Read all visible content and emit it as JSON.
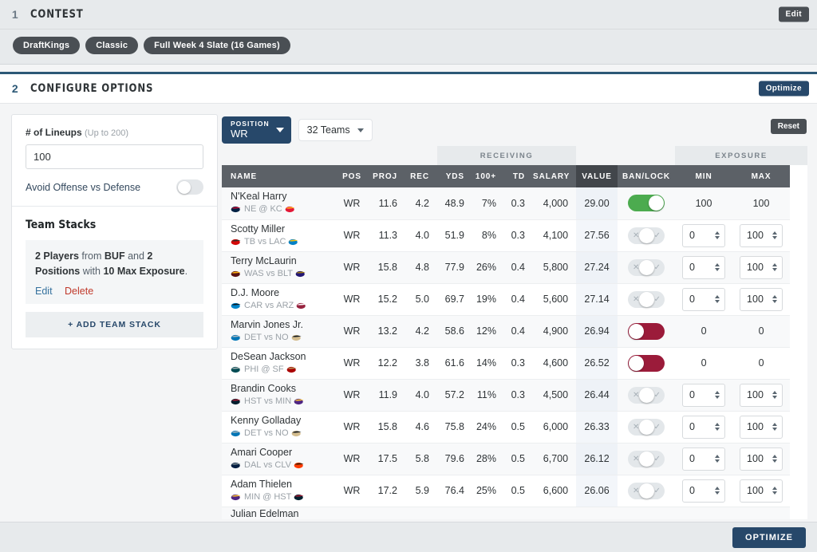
{
  "contest": {
    "step_number": "1",
    "title": "CONTEST",
    "edit_label": "Edit",
    "tags": [
      "DraftKings",
      "Classic",
      "Full Week 4 Slate (16 Games)"
    ]
  },
  "configure": {
    "step_number": "2",
    "title": "CONFIGURE OPTIONS",
    "optimize_label": "Optimize"
  },
  "sidebar": {
    "lineups_label": "# of Lineups",
    "lineups_hint": "(Up to 200)",
    "lineups_value": "100",
    "lineups_placeholder": "100",
    "avoid_label": "Avoid Offense vs Defense",
    "avoid_enabled": false,
    "team_stacks_heading": "Team Stacks",
    "stack": {
      "players_count": "2 Players",
      "from_word": "from",
      "team": "BUF",
      "and_word": "and",
      "positions": "2 Positions",
      "with_word": "with",
      "max_exposure": "10 Max Exposure",
      "full_text": "2 Players from BUF and 2 Positions with 10 Max Exposure.",
      "edit_label": "Edit",
      "delete_label": "Delete"
    },
    "add_stack_label": "+ ADD TEAM STACK"
  },
  "filters": {
    "position_label": "POSITION",
    "position_value": "WR",
    "teams_value": "32 Teams",
    "reset_label": "Reset"
  },
  "table": {
    "group_headers": [
      {
        "label": "",
        "span": 4
      },
      {
        "label": "RECEIVING",
        "span": 4
      },
      {
        "label": "",
        "span": 2
      },
      {
        "label": "EXPOSURE",
        "span": 3
      }
    ],
    "columns": [
      "NAME",
      "POS",
      "PROJ",
      "REC",
      "YDS",
      "100+",
      "TD",
      "SALARY",
      "VALUE",
      "BAN/LOCK",
      "MIN",
      "MAX"
    ],
    "sorted_column": "VALUE",
    "rows": [
      {
        "name": "N'Keal Harry",
        "team": "NE",
        "vs": "@",
        "opp": "KC",
        "pos": "WR",
        "proj": "11.6",
        "rec": "4.2",
        "yds": "48.9",
        "hundred": "7%",
        "td": "0.3",
        "salary": "4,000",
        "value": "29.00",
        "state": "lock",
        "min": "100",
        "max": "100",
        "editable": false
      },
      {
        "name": "Scotty Miller",
        "team": "TB",
        "vs": "vs",
        "opp": "LAC",
        "pos": "WR",
        "proj": "11.3",
        "rec": "4.0",
        "yds": "51.9",
        "hundred": "8%",
        "td": "0.3",
        "salary": "4,100",
        "value": "27.56",
        "state": "neutral",
        "min": "0",
        "max": "100",
        "editable": true
      },
      {
        "name": "Terry McLaurin",
        "team": "WAS",
        "vs": "vs",
        "opp": "BLT",
        "pos": "WR",
        "proj": "15.8",
        "rec": "4.8",
        "yds": "77.9",
        "hundred": "26%",
        "td": "0.4",
        "salary": "5,800",
        "value": "27.24",
        "state": "neutral",
        "min": "0",
        "max": "100",
        "editable": true
      },
      {
        "name": "D.J. Moore",
        "team": "CAR",
        "vs": "vs",
        "opp": "ARZ",
        "pos": "WR",
        "proj": "15.2",
        "rec": "5.0",
        "yds": "69.7",
        "hundred": "19%",
        "td": "0.4",
        "salary": "5,600",
        "value": "27.14",
        "state": "neutral",
        "min": "0",
        "max": "100",
        "editable": true
      },
      {
        "name": "Marvin Jones Jr.",
        "team": "DET",
        "vs": "vs",
        "opp": "NO",
        "pos": "WR",
        "proj": "13.2",
        "rec": "4.2",
        "yds": "58.6",
        "hundred": "12%",
        "td": "0.4",
        "salary": "4,900",
        "value": "26.94",
        "state": "ban",
        "min": "0",
        "max": "0",
        "editable": false
      },
      {
        "name": "DeSean Jackson",
        "team": "PHI",
        "vs": "@",
        "opp": "SF",
        "pos": "WR",
        "proj": "12.2",
        "rec": "3.8",
        "yds": "61.6",
        "hundred": "14%",
        "td": "0.3",
        "salary": "4,600",
        "value": "26.52",
        "state": "ban",
        "min": "0",
        "max": "0",
        "editable": false
      },
      {
        "name": "Brandin Cooks",
        "team": "HST",
        "vs": "vs",
        "opp": "MIN",
        "pos": "WR",
        "proj": "11.9",
        "rec": "4.0",
        "yds": "57.2",
        "hundred": "11%",
        "td": "0.3",
        "salary": "4,500",
        "value": "26.44",
        "state": "neutral",
        "min": "0",
        "max": "100",
        "editable": true
      },
      {
        "name": "Kenny Golladay",
        "team": "DET",
        "vs": "vs",
        "opp": "NO",
        "pos": "WR",
        "proj": "15.8",
        "rec": "4.6",
        "yds": "75.8",
        "hundred": "24%",
        "td": "0.5",
        "salary": "6,000",
        "value": "26.33",
        "state": "neutral",
        "min": "0",
        "max": "100",
        "editable": true
      },
      {
        "name": "Amari Cooper",
        "team": "DAL",
        "vs": "vs",
        "opp": "CLV",
        "pos": "WR",
        "proj": "17.5",
        "rec": "5.8",
        "yds": "79.6",
        "hundred": "28%",
        "td": "0.5",
        "salary": "6,700",
        "value": "26.12",
        "state": "neutral",
        "min": "0",
        "max": "100",
        "editable": true
      },
      {
        "name": "Adam Thielen",
        "team": "MIN",
        "vs": "@",
        "opp": "HST",
        "pos": "WR",
        "proj": "17.2",
        "rec": "5.9",
        "yds": "76.4",
        "hundred": "25%",
        "td": "0.5",
        "salary": "6,600",
        "value": "26.06",
        "state": "neutral",
        "min": "0",
        "max": "100",
        "editable": true
      }
    ]
  },
  "footer": {
    "optimize_label": "OPTIMIZE"
  },
  "colors": {
    "navy": "#27486a",
    "dark_gray": "#4a4f54",
    "header_gray": "#5c6167",
    "lock_green": "#4cab4f",
    "ban_maroon": "#9b1b3a",
    "link_blue": "#36729e",
    "delete_red": "#c0392b"
  }
}
